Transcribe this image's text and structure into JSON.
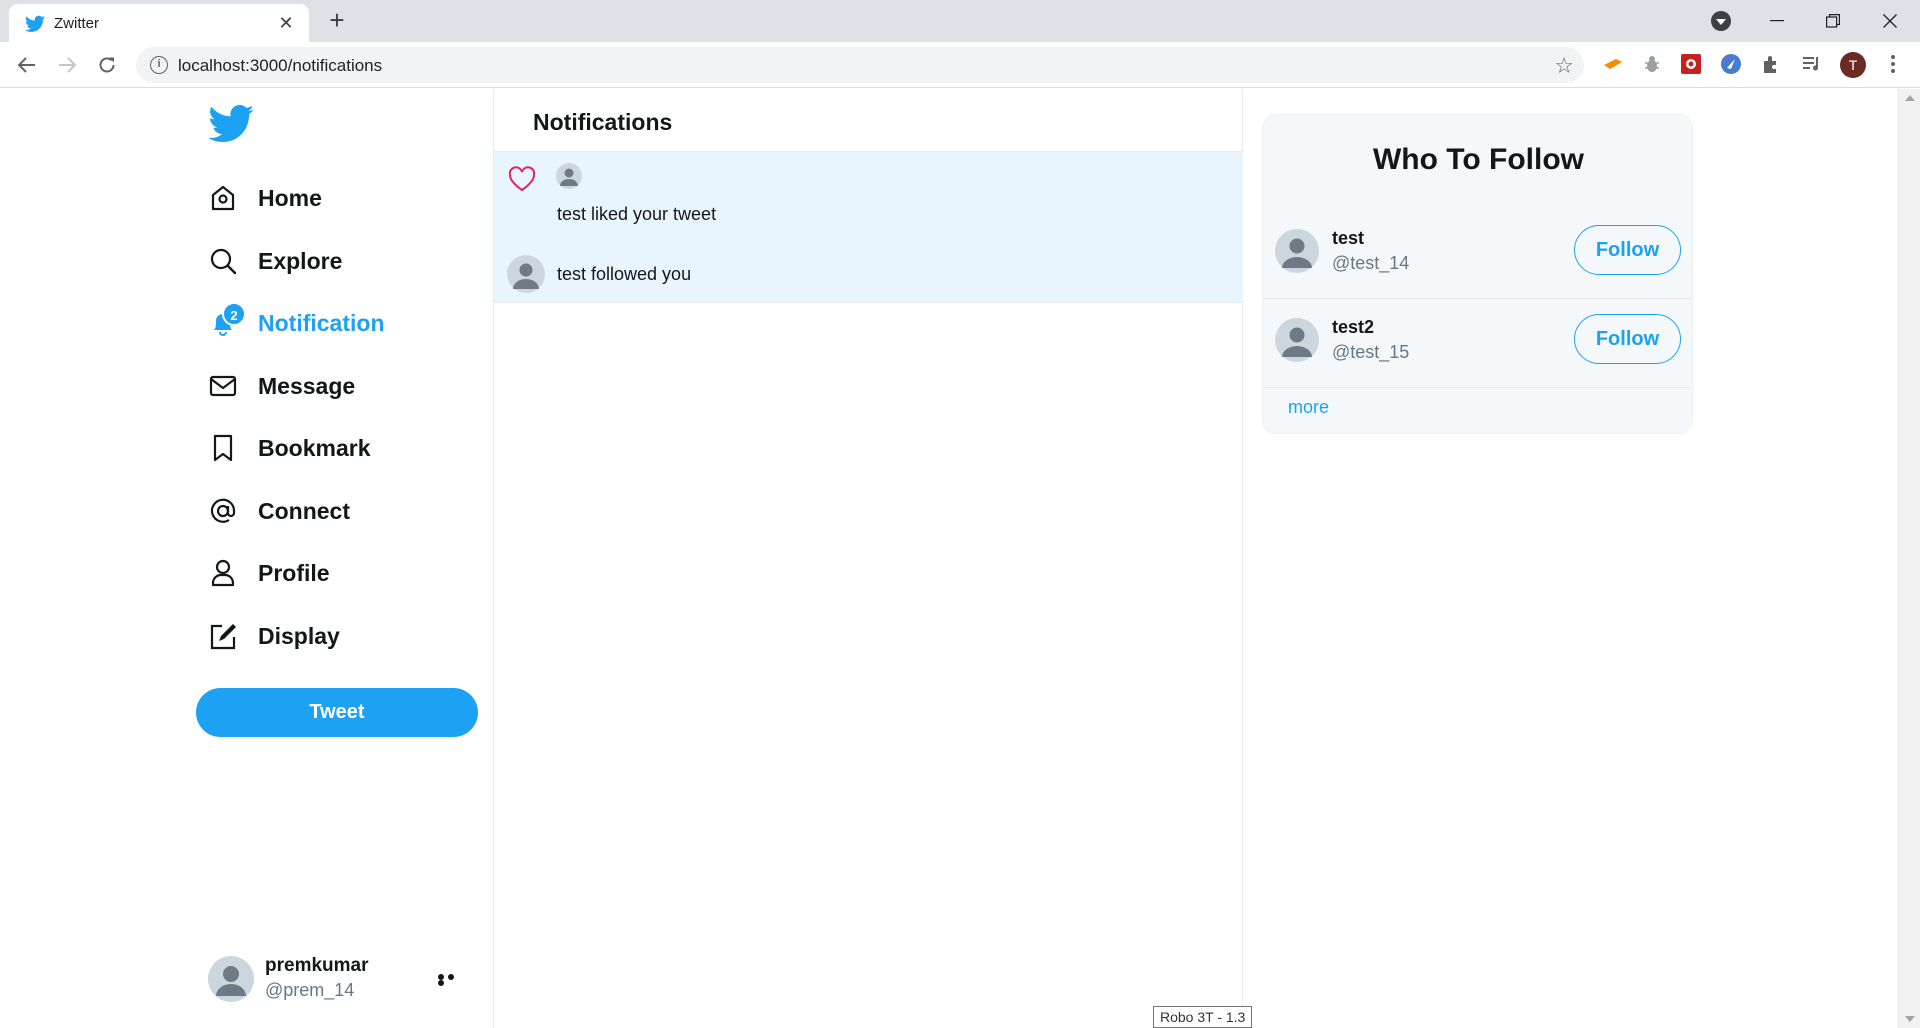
{
  "browser": {
    "tab_title": "Zwitter",
    "url": "localhost:3000/notifications",
    "profile_initial": "T"
  },
  "sidebar": {
    "items": [
      {
        "label": "Home",
        "icon": "home-icon"
      },
      {
        "label": "Explore",
        "icon": "search-icon"
      },
      {
        "label": "Notification",
        "icon": "bell-icon",
        "badge": "2",
        "active": true
      },
      {
        "label": "Message",
        "icon": "mail-icon"
      },
      {
        "label": "Bookmark",
        "icon": "bookmark-icon"
      },
      {
        "label": "Connect",
        "icon": "at-icon"
      },
      {
        "label": "Profile",
        "icon": "user-icon"
      },
      {
        "label": "Display",
        "icon": "edit-icon"
      }
    ],
    "tweet_label": "Tweet",
    "user": {
      "name": "premkumar",
      "handle": "@prem_14"
    }
  },
  "main": {
    "title": "Notifications",
    "notifications": [
      {
        "type": "like",
        "text": "test liked your tweet"
      },
      {
        "type": "follow",
        "text": "test followed you"
      }
    ]
  },
  "who_to_follow": {
    "title": "Who To Follow",
    "users": [
      {
        "name": "test",
        "handle": "@test_14",
        "button": "Follow"
      },
      {
        "name": "test2",
        "handle": "@test_15",
        "button": "Follow"
      }
    ],
    "more_label": "more"
  },
  "tooltip": "Robo 3T - 1.3",
  "colors": {
    "accent": "#1da1f2",
    "like": "#e0245e",
    "highlight_bg": "#e8f5fe"
  }
}
